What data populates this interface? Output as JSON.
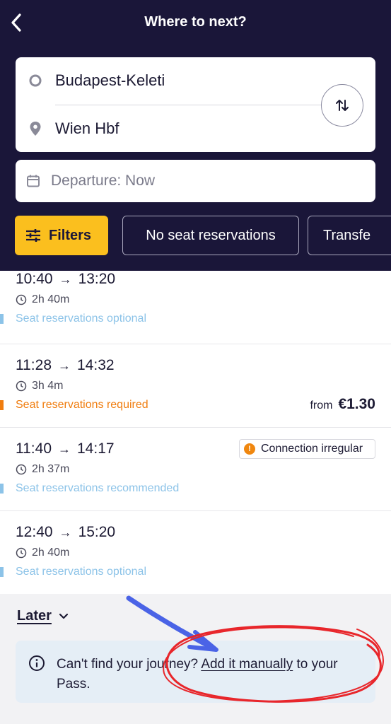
{
  "header": {
    "title": "Where to next?",
    "back_icon": "chevron-left-icon"
  },
  "route": {
    "from": "Budapest-Keleti",
    "to": "Wien Hbf",
    "swap_icon": "swap-vertical-icon"
  },
  "departure": {
    "label": "Departure: Now"
  },
  "chips": {
    "filters": "Filters",
    "no_seat": "No seat reservations",
    "transfer": "Transfe"
  },
  "results": [
    {
      "depart": "10:40",
      "arrive": "13:20",
      "duration": "2h 40m",
      "seat": "Seat reservations optional",
      "seat_color": "#8cc3e8",
      "price_from": "",
      "price": "",
      "badge": ""
    },
    {
      "depart": "11:28",
      "arrive": "14:32",
      "duration": "3h 4m",
      "seat": "Seat reservations required",
      "seat_color": "#f07d0f",
      "price_from": "from",
      "price": "€1.30",
      "badge": ""
    },
    {
      "depart": "11:40",
      "arrive": "14:17",
      "duration": "2h 37m",
      "seat": "Seat reservations recommended",
      "seat_color": "#8cc3e8",
      "price_from": "",
      "price": "",
      "badge": "Connection irregular"
    },
    {
      "depart": "12:40",
      "arrive": "15:20",
      "duration": "2h 40m",
      "seat": "Seat reservations optional",
      "seat_color": "#8cc3e8",
      "price_from": "",
      "price": "",
      "badge": ""
    }
  ],
  "later": {
    "label": "Later"
  },
  "info": {
    "prefix": "Can't find your journey? ",
    "link": "Add it manually",
    "suffix": " to your Pass."
  },
  "colors": {
    "header_bg": "#1a1639",
    "accent_yellow": "#fbbf1e",
    "annotation_red": "#e8262b",
    "annotation_blue": "#4a63e6"
  }
}
